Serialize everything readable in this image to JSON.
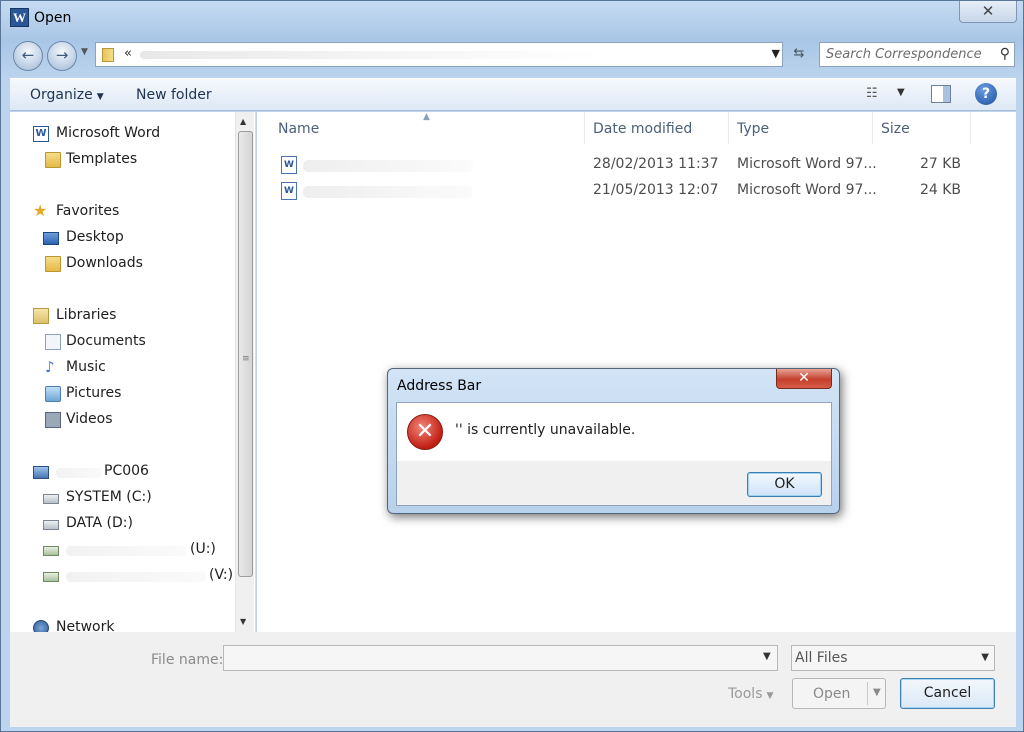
{
  "window": {
    "title": "Open",
    "close_glyph": "✕"
  },
  "nav": {
    "back_glyph": "←",
    "forward_glyph": "→"
  },
  "address_bar": {
    "prefix": "«",
    "path": ""
  },
  "search": {
    "placeholder": "Search Correspondence ..."
  },
  "toolbar": {
    "organize": "Organize",
    "new_folder": "New folder"
  },
  "sidebar": {
    "items": [
      {
        "label": "Microsoft Word",
        "icon": "word-icon"
      },
      {
        "label": "Templates",
        "icon": "folder-icon"
      },
      {
        "label": "Favorites",
        "icon": "star-icon"
      },
      {
        "label": "Desktop",
        "icon": "desktop-icon"
      },
      {
        "label": "Downloads",
        "icon": "downloads-folder-icon"
      },
      {
        "label": "Libraries",
        "icon": "library-icon"
      },
      {
        "label": "Documents",
        "icon": "documents-icon"
      },
      {
        "label": "Music",
        "icon": "music-icon"
      },
      {
        "label": "Pictures",
        "icon": "pictures-icon"
      },
      {
        "label": "Videos",
        "icon": "videos-icon"
      },
      {
        "label": "PC006",
        "icon": "computer-icon"
      },
      {
        "label": "SYSTEM (C:)",
        "icon": "drive-icon"
      },
      {
        "label": "DATA (D:)",
        "icon": "drive-icon"
      },
      {
        "label": "(U:)",
        "icon": "network-drive-icon"
      },
      {
        "label": "(V:)",
        "icon": "network-drive-icon"
      },
      {
        "label": "Network",
        "icon": "network-icon"
      }
    ]
  },
  "file_list": {
    "columns": [
      "Name",
      "Date modified",
      "Type",
      "Size"
    ],
    "rows": [
      {
        "name": "",
        "date": "28/02/2013 11:37",
        "type": "Microsoft Word 97...",
        "size": "27 KB"
      },
      {
        "name": "",
        "date": "21/05/2013 12:07",
        "type": "Microsoft Word 97...",
        "size": "24 KB"
      }
    ]
  },
  "footer": {
    "file_name_label": "File name:",
    "file_name_value": "",
    "filter": "All Files",
    "tools": "Tools",
    "open": "Open",
    "cancel": "Cancel"
  },
  "dialog": {
    "title": "Address Bar",
    "message": "'' is currently unavailable.",
    "ok": "OK"
  }
}
